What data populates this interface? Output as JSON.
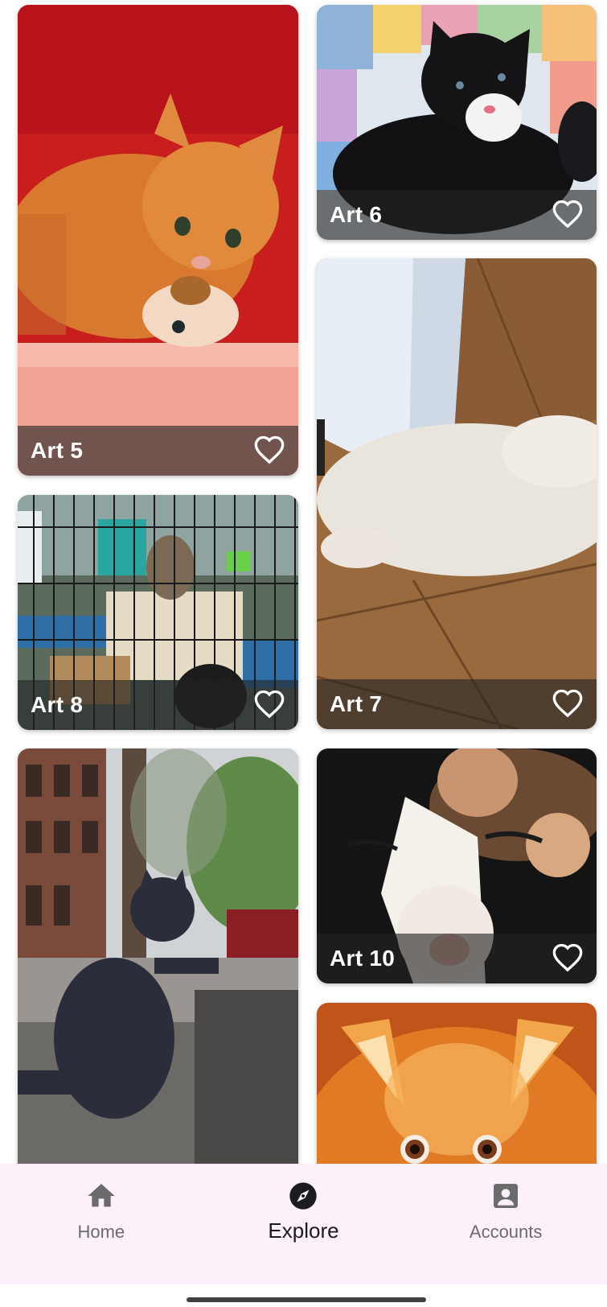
{
  "cards": [
    {
      "id": "art5",
      "title": "Art 5"
    },
    {
      "id": "art6",
      "title": "Art 6"
    },
    {
      "id": "art7",
      "title": "Art 7"
    },
    {
      "id": "art8",
      "title": "Art 8"
    },
    {
      "id": "art10",
      "title": "Art 10"
    }
  ],
  "nav": {
    "items": [
      {
        "label": "Home",
        "icon": "home-icon",
        "active": false
      },
      {
        "label": "Explore",
        "icon": "compass-icon",
        "active": true
      },
      {
        "label": "Accounts",
        "icon": "account-box-icon",
        "active": false
      }
    ]
  },
  "colors": {
    "nav_background": "#fcf1fb",
    "caption_overlay": "rgba(35,35,35,0.62)",
    "active_label": "#1c1b1f",
    "inactive_label": "#6b6b6b"
  }
}
